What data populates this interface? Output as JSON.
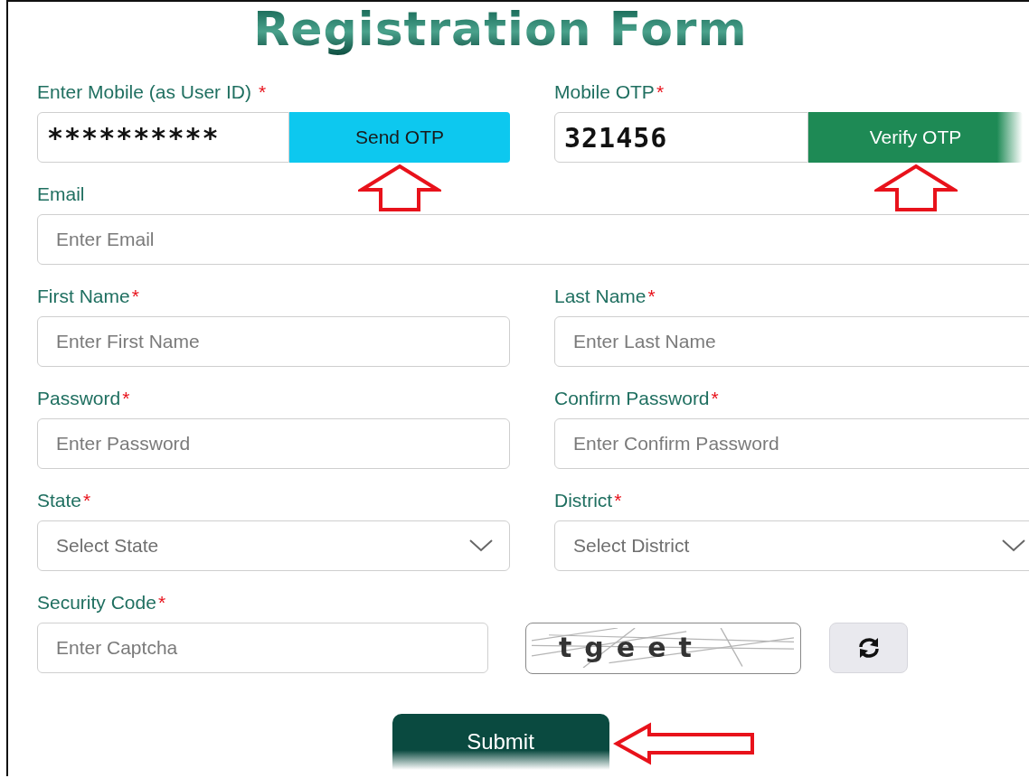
{
  "title": "Registration Form",
  "rows": [
    {
      "fields": [
        {
          "kind": "input-button",
          "label": "Enter Mobile (as User ID)",
          "required": "*",
          "value": "**********",
          "button": {
            "label": "Send OTP",
            "color": "#0dc8ef"
          },
          "pointer": true
        },
        {
          "kind": "input-button",
          "label": "Mobile OTP",
          "required": "*",
          "value": "321456",
          "button": {
            "label": "Verify OTP",
            "color": "#1e8a55"
          },
          "pointer": true
        }
      ]
    },
    {
      "fields": [
        {
          "kind": "input",
          "label": "Email",
          "placeholder": "Enter Email"
        }
      ]
    },
    {
      "fields": [
        {
          "kind": "input",
          "label": "First Name",
          "required": "*",
          "placeholder": "Enter First Name"
        },
        {
          "kind": "input",
          "label": "Last Name",
          "required": "*",
          "placeholder": "Enter Last Name"
        }
      ]
    },
    {
      "fields": [
        {
          "kind": "input",
          "label": "Password",
          "required": "*",
          "placeholder": "Enter Password"
        },
        {
          "kind": "input",
          "label": "Confirm Password",
          "required": "*",
          "placeholder": "Enter Confirm Password"
        }
      ]
    },
    {
      "fields": [
        {
          "kind": "select",
          "label": "State",
          "required": "*",
          "placeholder": "Select State"
        },
        {
          "kind": "select",
          "label": "District",
          "required": "*",
          "placeholder": "Select District"
        }
      ]
    },
    {
      "fields": [
        {
          "kind": "captcha",
          "label": "Security Code",
          "required": "*",
          "placeholder": "Enter Captcha",
          "captcha_text": "tgeet"
        }
      ]
    }
  ],
  "submit": {
    "label": "Submit",
    "pointer": true
  }
}
